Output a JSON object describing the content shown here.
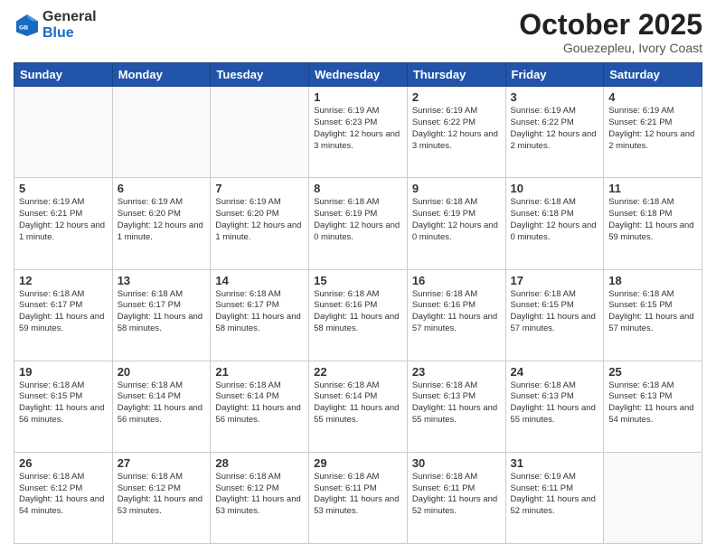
{
  "logo": {
    "general": "General",
    "blue": "Blue"
  },
  "title": "October 2025",
  "subtitle": "Gouezepleu, Ivory Coast",
  "days_of_week": [
    "Sunday",
    "Monday",
    "Tuesday",
    "Wednesday",
    "Thursday",
    "Friday",
    "Saturday"
  ],
  "weeks": [
    [
      {
        "day": "",
        "info": ""
      },
      {
        "day": "",
        "info": ""
      },
      {
        "day": "",
        "info": ""
      },
      {
        "day": "1",
        "info": "Sunrise: 6:19 AM\nSunset: 6:23 PM\nDaylight: 12 hours\nand 3 minutes."
      },
      {
        "day": "2",
        "info": "Sunrise: 6:19 AM\nSunset: 6:22 PM\nDaylight: 12 hours\nand 3 minutes."
      },
      {
        "day": "3",
        "info": "Sunrise: 6:19 AM\nSunset: 6:22 PM\nDaylight: 12 hours\nand 2 minutes."
      },
      {
        "day": "4",
        "info": "Sunrise: 6:19 AM\nSunset: 6:21 PM\nDaylight: 12 hours\nand 2 minutes."
      }
    ],
    [
      {
        "day": "5",
        "info": "Sunrise: 6:19 AM\nSunset: 6:21 PM\nDaylight: 12 hours\nand 1 minute."
      },
      {
        "day": "6",
        "info": "Sunrise: 6:19 AM\nSunset: 6:20 PM\nDaylight: 12 hours\nand 1 minute."
      },
      {
        "day": "7",
        "info": "Sunrise: 6:19 AM\nSunset: 6:20 PM\nDaylight: 12 hours\nand 1 minute."
      },
      {
        "day": "8",
        "info": "Sunrise: 6:18 AM\nSunset: 6:19 PM\nDaylight: 12 hours\nand 0 minutes."
      },
      {
        "day": "9",
        "info": "Sunrise: 6:18 AM\nSunset: 6:19 PM\nDaylight: 12 hours\nand 0 minutes."
      },
      {
        "day": "10",
        "info": "Sunrise: 6:18 AM\nSunset: 6:18 PM\nDaylight: 12 hours\nand 0 minutes."
      },
      {
        "day": "11",
        "info": "Sunrise: 6:18 AM\nSunset: 6:18 PM\nDaylight: 11 hours\nand 59 minutes."
      }
    ],
    [
      {
        "day": "12",
        "info": "Sunrise: 6:18 AM\nSunset: 6:17 PM\nDaylight: 11 hours\nand 59 minutes."
      },
      {
        "day": "13",
        "info": "Sunrise: 6:18 AM\nSunset: 6:17 PM\nDaylight: 11 hours\nand 58 minutes."
      },
      {
        "day": "14",
        "info": "Sunrise: 6:18 AM\nSunset: 6:17 PM\nDaylight: 11 hours\nand 58 minutes."
      },
      {
        "day": "15",
        "info": "Sunrise: 6:18 AM\nSunset: 6:16 PM\nDaylight: 11 hours\nand 58 minutes."
      },
      {
        "day": "16",
        "info": "Sunrise: 6:18 AM\nSunset: 6:16 PM\nDaylight: 11 hours\nand 57 minutes."
      },
      {
        "day": "17",
        "info": "Sunrise: 6:18 AM\nSunset: 6:15 PM\nDaylight: 11 hours\nand 57 minutes."
      },
      {
        "day": "18",
        "info": "Sunrise: 6:18 AM\nSunset: 6:15 PM\nDaylight: 11 hours\nand 57 minutes."
      }
    ],
    [
      {
        "day": "19",
        "info": "Sunrise: 6:18 AM\nSunset: 6:15 PM\nDaylight: 11 hours\nand 56 minutes."
      },
      {
        "day": "20",
        "info": "Sunrise: 6:18 AM\nSunset: 6:14 PM\nDaylight: 11 hours\nand 56 minutes."
      },
      {
        "day": "21",
        "info": "Sunrise: 6:18 AM\nSunset: 6:14 PM\nDaylight: 11 hours\nand 56 minutes."
      },
      {
        "day": "22",
        "info": "Sunrise: 6:18 AM\nSunset: 6:14 PM\nDaylight: 11 hours\nand 55 minutes."
      },
      {
        "day": "23",
        "info": "Sunrise: 6:18 AM\nSunset: 6:13 PM\nDaylight: 11 hours\nand 55 minutes."
      },
      {
        "day": "24",
        "info": "Sunrise: 6:18 AM\nSunset: 6:13 PM\nDaylight: 11 hours\nand 55 minutes."
      },
      {
        "day": "25",
        "info": "Sunrise: 6:18 AM\nSunset: 6:13 PM\nDaylight: 11 hours\nand 54 minutes."
      }
    ],
    [
      {
        "day": "26",
        "info": "Sunrise: 6:18 AM\nSunset: 6:12 PM\nDaylight: 11 hours\nand 54 minutes."
      },
      {
        "day": "27",
        "info": "Sunrise: 6:18 AM\nSunset: 6:12 PM\nDaylight: 11 hours\nand 53 minutes."
      },
      {
        "day": "28",
        "info": "Sunrise: 6:18 AM\nSunset: 6:12 PM\nDaylight: 11 hours\nand 53 minutes."
      },
      {
        "day": "29",
        "info": "Sunrise: 6:18 AM\nSunset: 6:11 PM\nDaylight: 11 hours\nand 53 minutes."
      },
      {
        "day": "30",
        "info": "Sunrise: 6:18 AM\nSunset: 6:11 PM\nDaylight: 11 hours\nand 52 minutes."
      },
      {
        "day": "31",
        "info": "Sunrise: 6:19 AM\nSunset: 6:11 PM\nDaylight: 11 hours\nand 52 minutes."
      },
      {
        "day": "",
        "info": ""
      }
    ]
  ]
}
